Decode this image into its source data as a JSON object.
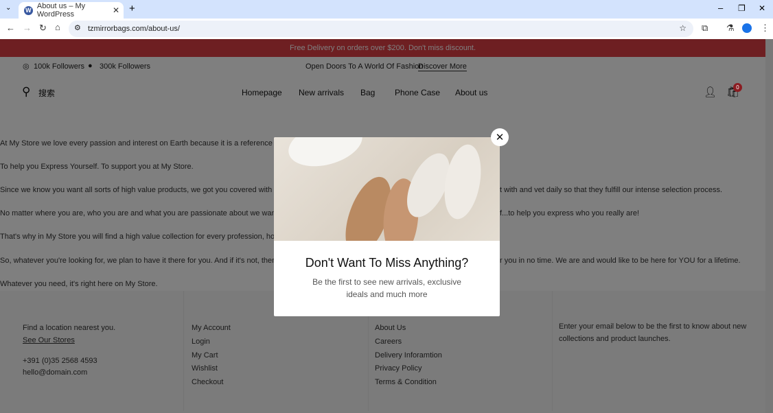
{
  "browser": {
    "tab_title": "About us – My WordPress",
    "url": "tzmirrorbags.com/about-us/"
  },
  "promo": "Free Delivery on orders over $200. Don't miss discount.",
  "social": {
    "instagram": "100k Followers",
    "facebook": "300k Followers"
  },
  "tagline": "Open Doors To A World Of Fashion",
  "discover": "Discover More",
  "search_label": "搜索",
  "nav": [
    "Homepage",
    "New arrivals",
    "Bag",
    "Phone Case",
    "About us"
  ],
  "cart_count": "0",
  "paragraphs": [
    "At My Store we love every passion and interest on Earth because it is a reference to your",
    "To help you Express Yourself. To support you at My Store.",
    "Since we know you want all sorts of high value products, we got you covered with highly p",
    "t with and vet daily so that they fulfill our intense selection process.",
    "No matter where you are, who you are and what you are passionate about we want to be a",
    "f...to help you express who you really are!",
    "That's why in My Store you will find a high value collection for every profession, hobby, sp",
    "So, whatever you're looking for, we plan to have it there for you. And if it's not, then conta",
    "r you in no time. We are and would like to be here for YOU for a lifetime.",
    "Whatever you need, it's right here on My Store."
  ],
  "footer": {
    "col1": {
      "text": "Find a location nearest you.",
      "link": "See Our Stores",
      "phone": "+391 (0)35 2568 4593",
      "email": "hello@domain.com"
    },
    "col2": [
      "My Account",
      "Login",
      "My Cart",
      "Wishlist",
      "Checkout"
    ],
    "col3": [
      "About Us",
      "Careers",
      "Delivery Inforamtion",
      "Privacy Policy",
      "Terms & Condition"
    ],
    "col4": [
      "Enter your email below to be the first to know about new",
      "collections and product launches."
    ]
  },
  "modal": {
    "title": "Don't Want To Miss Anything?",
    "line1": "Be the first to see new arrivals, exclusive",
    "line2": "ideals and much more"
  }
}
